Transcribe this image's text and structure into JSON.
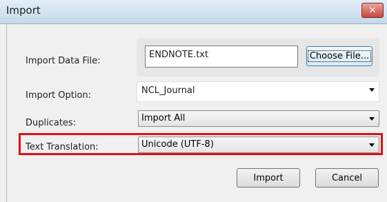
{
  "window": {
    "title": "Import",
    "close_label": "✕"
  },
  "form": {
    "import_data_file_label": "Import Data File:",
    "import_data_file_value": "ENDNOTE.txt",
    "choose_file_label": "Choose File...",
    "import_option_label": "Import Option:",
    "import_option_value": "NCL_Journal",
    "duplicates_label": "Duplicates:",
    "duplicates_value": "Import All",
    "text_translation_label": "Text Translation:",
    "text_translation_value": "Unicode (UTF-8)"
  },
  "buttons": {
    "import_label": "Import",
    "cancel_label": "Cancel"
  },
  "colors": {
    "highlight": "#e01010",
    "title_bar": "#c6d9ea",
    "close_button": "#c9463a"
  },
  "icons": {
    "close": "close-icon",
    "dropdown": "chevron-down-icon"
  }
}
